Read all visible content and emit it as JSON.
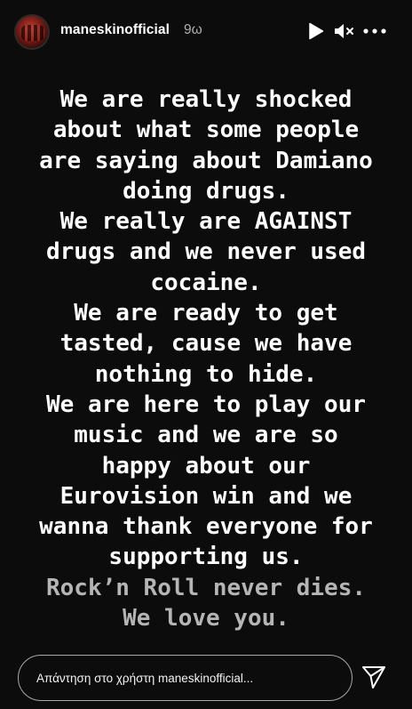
{
  "header": {
    "username": "maneskinofficial",
    "timestamp": "9ω",
    "icons": [
      "play-icon",
      "mute-icon",
      "more-icon"
    ]
  },
  "story": {
    "lines": [
      {
        "text": "We are really shocked",
        "tone": "white"
      },
      {
        "text": "about what some people",
        "tone": "white"
      },
      {
        "text": "are saying about Damiano",
        "tone": "white"
      },
      {
        "text": "doing drugs.",
        "tone": "white"
      },
      {
        "text": "We really are AGAINST",
        "tone": "white"
      },
      {
        "text": "drugs and we never used",
        "tone": "white"
      },
      {
        "text": "cocaine.",
        "tone": "white"
      },
      {
        "text": "We are ready to get",
        "tone": "white"
      },
      {
        "text": "tasted, cause we have",
        "tone": "white"
      },
      {
        "text": "nothing to hide.",
        "tone": "white"
      },
      {
        "text": "We are here to play our",
        "tone": "white"
      },
      {
        "text": "music and we are so",
        "tone": "white"
      },
      {
        "text": "happy about our",
        "tone": "white"
      },
      {
        "text": "Eurovision win and we",
        "tone": "white"
      },
      {
        "text": "wanna thank everyone for",
        "tone": "white"
      },
      {
        "text": "supporting us.",
        "tone": "white"
      },
      {
        "text": "Rock’n Roll never dies.",
        "tone": "grey"
      },
      {
        "text": "We love you.",
        "tone": "grey"
      }
    ],
    "colors": {
      "white": "#ffffff",
      "grey": "#b5b5b5",
      "background": "#0c0c0c"
    }
  },
  "footer": {
    "reply_placeholder": "Απάντηση στο χρήστη maneskinofficial...",
    "send_icon": "send-icon"
  }
}
